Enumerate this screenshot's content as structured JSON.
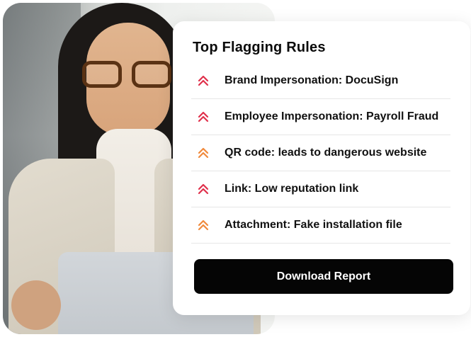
{
  "card": {
    "title": "Top Flagging Rules",
    "download_label": "Download Report"
  },
  "severity_colors": {
    "high": "#e0304b",
    "medium": "#f08a3c"
  },
  "rules": [
    {
      "label": "Brand Impersonation: DocuSign",
      "severity": "high",
      "icon": "double-chevron-up-icon"
    },
    {
      "label": "Employee Impersonation: Payroll Fraud",
      "severity": "high",
      "icon": "double-chevron-up-icon"
    },
    {
      "label": "QR code: leads to dangerous website",
      "severity": "medium",
      "icon": "double-chevron-up-icon"
    },
    {
      "label": "Link: Low reputation link",
      "severity": "high",
      "icon": "double-chevron-up-icon"
    },
    {
      "label": "Attachment: Fake installation file",
      "severity": "medium",
      "icon": "double-chevron-up-icon"
    }
  ]
}
